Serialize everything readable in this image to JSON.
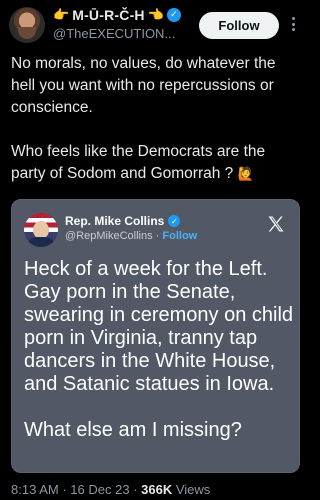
{
  "tweet": {
    "display_name": "M-Ū-R-Č-H",
    "handle": "@TheEXECUTION...",
    "follow_label": "Follow",
    "text_para1": "No morals, no values, do whatever the hell you want with no repercussions or conscience.",
    "text_para2": "Who feels like the Democrats are the party of Sodom and Gomorrah ?",
    "emoji_left": "👉",
    "emoji_right": "👈",
    "emoji_end": "🙋",
    "time": "8:13 AM",
    "date": "16 Dec 23",
    "views_count": "366K",
    "views_label": "Views"
  },
  "quote": {
    "name": "Rep. Mike Collins",
    "handle": "@RepMikeCollins",
    "follow_label": "Follow",
    "body_para1": "Heck of a week for the Left. Gay porn in the Senate, swearing in ceremony on child porn in Virginia, tranny tap dancers in the White House, and Satanic statues in Iowa.",
    "body_para2": "What else am I missing?"
  },
  "colors": {
    "background": "#000000",
    "verified_blue": "#1d9bf0",
    "quote_card": "#525866",
    "secondary_text": "#8b98a5"
  }
}
